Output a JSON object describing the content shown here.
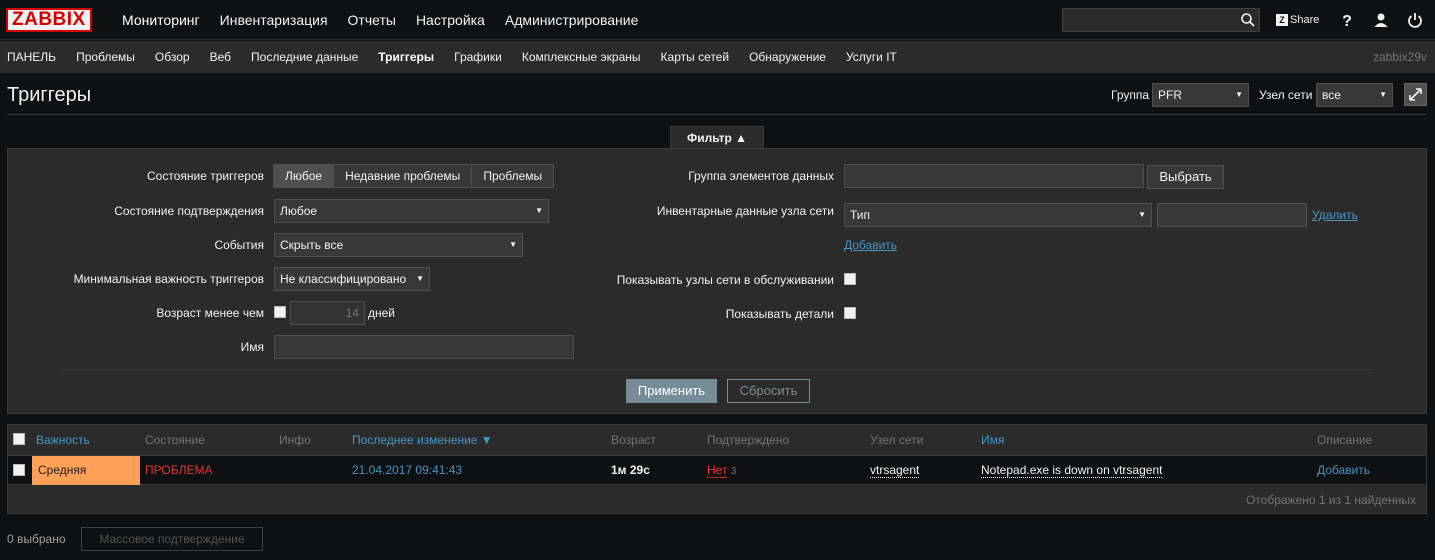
{
  "brand": {
    "logo": "ZABBIX",
    "logo_color": "#d40000"
  },
  "top_menu": [
    {
      "label": "Мониторинг",
      "active": true
    },
    {
      "label": "Инвентаризация"
    },
    {
      "label": "Отчеты"
    },
    {
      "label": "Настройка"
    },
    {
      "label": "Администрирование"
    }
  ],
  "top_right": {
    "search_value": "",
    "share_label": "Share",
    "share_badge": "Z"
  },
  "sub_menu": [
    {
      "label": "ПАНЕЛЬ"
    },
    {
      "label": "Проблемы"
    },
    {
      "label": "Обзор"
    },
    {
      "label": "Веб"
    },
    {
      "label": "Последние данные"
    },
    {
      "label": "Триггеры",
      "active": true
    },
    {
      "label": "Графики"
    },
    {
      "label": "Комплексные экраны"
    },
    {
      "label": "Карты сетей"
    },
    {
      "label": "Обнаружение"
    },
    {
      "label": "Услуги IT"
    }
  ],
  "server_name": "zabbix29v",
  "header": {
    "title": "Триггеры",
    "group_label": "Группа",
    "group_value": "PFR",
    "host_label": "Узел сети",
    "host_value": "все"
  },
  "filter": {
    "tab_label": "Фильтр ▲",
    "trigger_state_label": "Состояние триггеров",
    "trigger_state_options": [
      "Любое",
      "Недавние проблемы",
      "Проблемы"
    ],
    "ack_state_label": "Состояние подтверждения",
    "ack_state_value": "Любое",
    "events_label": "События",
    "events_value": "Скрыть все",
    "min_severity_label": "Минимальная важность триггеров",
    "min_severity_value": "Не классифицировано",
    "age_label": "Возраст менее чем",
    "age_value": "14",
    "age_unit": "дней",
    "name_label": "Имя",
    "name_value": "",
    "app_group_label": "Группа элементов данных",
    "app_group_value": "",
    "select_button": "Выбрать",
    "inventory_label": "Инвентарные данные узла сети",
    "inventory_field": "Тип",
    "inventory_value": "",
    "remove_link": "Удалить",
    "add_link": "Добавить",
    "maintenance_label": "Показывать узлы сети в обслуживании",
    "details_label": "Показывать детали",
    "apply_button": "Применить",
    "reset_button": "Сбросить"
  },
  "table": {
    "columns": [
      "Важность",
      "Состояние",
      "Инфо",
      "Последнее изменение ▼",
      "Возраст",
      "Подтверждено",
      "Узел сети",
      "Имя",
      "Описание"
    ],
    "rows": [
      {
        "severity": "Средняя",
        "severity_color": "#ffa059",
        "status": "ПРОБЛЕМА",
        "info": "",
        "last_change": "21.04.2017 09:41:43",
        "age": "1м 29с",
        "ack": "Нет",
        "ack_count": "3",
        "host": "vtrsagent",
        "name": "Notepad.exe is down on vtrsagent",
        "description": "Добавить"
      }
    ],
    "footer": "Отображено 1 из 1 найденных"
  },
  "bottom": {
    "selected": "0 выбрано",
    "mass_ack_button": "Массовое подтверждение"
  }
}
